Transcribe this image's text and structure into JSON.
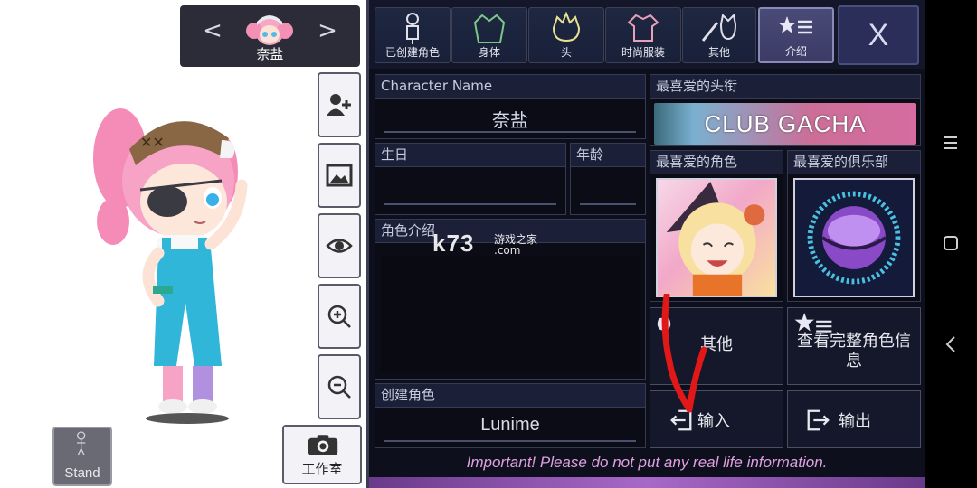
{
  "switcher": {
    "prev": "<",
    "next": ">",
    "name": "奈盐"
  },
  "tools": [
    {
      "name": "add-character"
    },
    {
      "name": "background"
    },
    {
      "name": "visibility"
    },
    {
      "name": "zoom-in"
    },
    {
      "name": "zoom-out"
    }
  ],
  "stand_label": "Stand",
  "studio_label": "工作室",
  "tabs": [
    {
      "label": "已创建角色",
      "icon": "person-icon"
    },
    {
      "label": "身体",
      "icon": "jacket-icon"
    },
    {
      "label": "头",
      "icon": "hair-icon"
    },
    {
      "label": "时尚服装",
      "icon": "shirt-icon"
    },
    {
      "label": "其他",
      "icon": "sword-cat-icon"
    },
    {
      "label": "介绍",
      "icon": "star-list-icon",
      "active": true
    }
  ],
  "close_label": "X",
  "profile": {
    "name_header": "Character Name",
    "name_value": "奈盐",
    "birthday_header": "生日",
    "birthday_value": "",
    "age_header": "年龄",
    "age_value": "",
    "intro_header": "角色介绍",
    "intro_value": "",
    "creator_header": "创建角色",
    "creator_value": "Lunime",
    "title_header": "最喜爱的头衔",
    "title_value": "CLUB GACHA",
    "fav_char_header": "最喜爱的角色",
    "fav_club_header": "最喜爱的俱乐部"
  },
  "actions": {
    "other": "其他",
    "full_info": "查看完整角色信息",
    "import": "输入",
    "export": "输出"
  },
  "important": "Important! Please do not put any real life information.",
  "watermark": {
    "logo": "k73",
    "site": "游戏之家",
    "url": ".com"
  },
  "colors": {
    "panel_bg": "#0d0f1c",
    "accent_active_tab": "#3b3b66",
    "important_text": "#e0a0e0"
  }
}
